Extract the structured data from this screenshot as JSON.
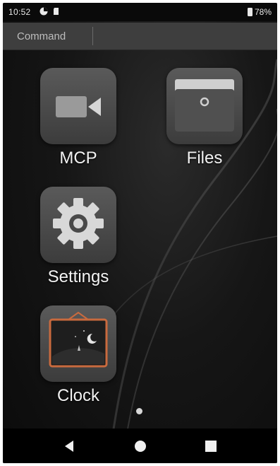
{
  "status_bar": {
    "time": "10:52",
    "battery_percent": "78%"
  },
  "command_bar": {
    "label": "Command"
  },
  "apps": [
    {
      "label": "MCP",
      "icon": "video-camera-icon"
    },
    {
      "label": "Files",
      "icon": "folder-icon"
    },
    {
      "label": "Settings",
      "icon": "gear-icon"
    },
    {
      "label": "Clock",
      "icon": "framed-night-scene-icon"
    }
  ],
  "navigation": {
    "back": "back-triangle-icon",
    "home": "home-circle-icon",
    "recent": "recent-square-icon"
  },
  "colors": {
    "wallpaper": "#141414",
    "tile": "#4a4a4a",
    "command_bar": "#3e3e3e",
    "clock_frame": "#c96a3e"
  }
}
